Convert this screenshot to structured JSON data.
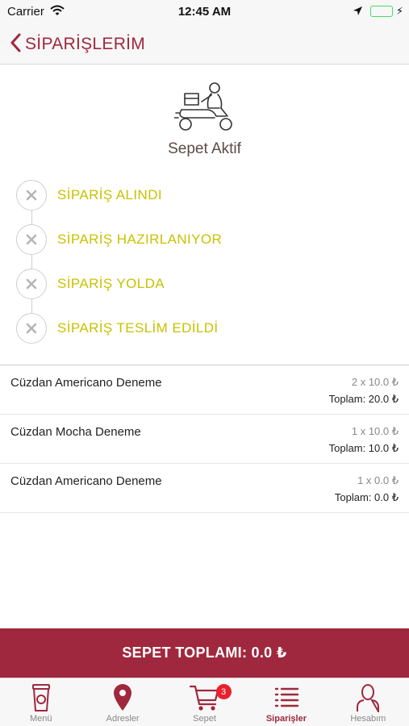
{
  "status_bar": {
    "carrier": "Carrier",
    "time": "12:45 AM",
    "icons": [
      "wifi-icon",
      "location-arrow-icon",
      "battery-icon",
      "charging-bolt-icon"
    ]
  },
  "nav": {
    "back_icon": "chevron-left-icon",
    "title": "SİPARİŞLERİM"
  },
  "hero": {
    "icon": "delivery-scooter-icon",
    "status": "Sepet Aktif"
  },
  "steps": [
    {
      "label": "SİPARİŞ ALINDI",
      "icon": "x-icon"
    },
    {
      "label": "SİPARİŞ HAZIRLANIYOR",
      "icon": "x-icon"
    },
    {
      "label": "SİPARİŞ YOLDA",
      "icon": "x-icon"
    },
    {
      "label": "SİPARİŞ TESLİM EDİLDİ",
      "icon": "x-icon"
    }
  ],
  "orders": [
    {
      "name": "Cüzdan Americano Deneme",
      "qty": "2 x 10.0 ₺",
      "total": "Toplam: 20.0 ₺"
    },
    {
      "name": "Cüzdan Mocha Deneme",
      "qty": "1 x 10.0 ₺",
      "total": "Toplam: 10.0 ₺"
    },
    {
      "name": "Cüzdan Americano Deneme",
      "qty": "1 x 0.0 ₺",
      "total": "Toplam: 0.0 ₺"
    }
  ],
  "cart_total": "SEPET TOPLAMI: 0.0 ₺",
  "tabs": [
    {
      "label": "Menü",
      "icon": "coffee-cup-icon",
      "active": false
    },
    {
      "label": "Adresler",
      "icon": "map-pin-icon",
      "active": false
    },
    {
      "label": "Sepet",
      "icon": "shopping-cart-icon",
      "active": false,
      "badge": "3"
    },
    {
      "label": "Siparişler",
      "icon": "list-icon",
      "active": true
    },
    {
      "label": "Hesabım",
      "icon": "user-icon",
      "active": false
    }
  ],
  "colors": {
    "brand": "#a0283e",
    "step_text": "#c9c100",
    "badge": "#e8212e",
    "battery": "#4cd964"
  }
}
